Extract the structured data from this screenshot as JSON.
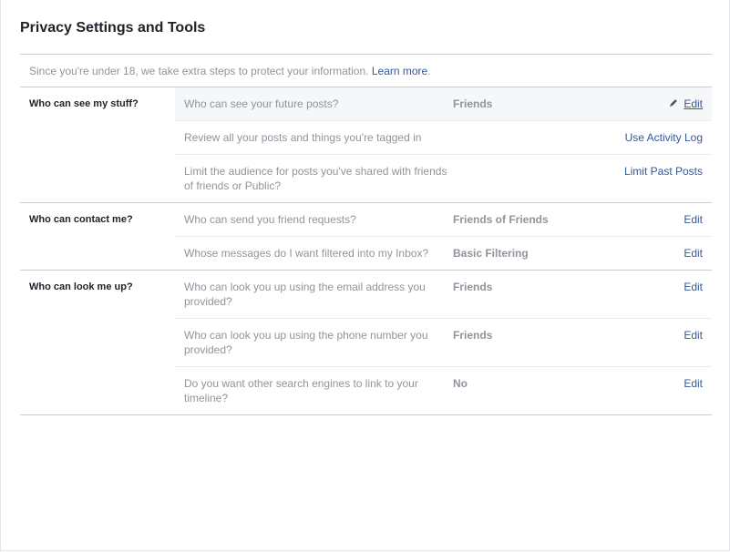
{
  "header": {
    "title": "Privacy Settings and Tools"
  },
  "notice": {
    "text": "Since you're under 18, we take extra steps to protect your information.",
    "link_label": "Learn more",
    "suffix": "."
  },
  "sections": [
    {
      "label": "Who can see my stuff?",
      "rows": [
        {
          "question": "Who can see your future posts?",
          "value": "Friends",
          "action": "Edit"
        },
        {
          "question": "Review all your posts and things you're tagged in",
          "value": "",
          "action": "Use Activity Log"
        },
        {
          "question": "Limit the audience for posts you've shared with friends of friends or Public?",
          "value": "",
          "action": "Limit Past Posts"
        }
      ]
    },
    {
      "label": "Who can contact me?",
      "rows": [
        {
          "question": "Who can send you friend requests?",
          "value": "Friends of Friends",
          "action": "Edit"
        },
        {
          "question": "Whose messages do I want filtered into my Inbox?",
          "value": "Basic Filtering",
          "action": "Edit"
        }
      ]
    },
    {
      "label": "Who can look me up?",
      "rows": [
        {
          "question": "Who can look you up using the email address you provided?",
          "value": "Friends",
          "action": "Edit"
        },
        {
          "question": "Who can look you up using the phone number you provided?",
          "value": "Friends",
          "action": "Edit"
        },
        {
          "question": "Do you want other search engines to link to your timeline?",
          "value": "No",
          "action": "Edit"
        }
      ]
    }
  ],
  "icons": {
    "edit": "pencil-icon"
  },
  "colors": {
    "link": "#365899",
    "muted_text": "#90949c",
    "highlight_row": "#f6f7f9",
    "divider": "#c9ccd1"
  }
}
